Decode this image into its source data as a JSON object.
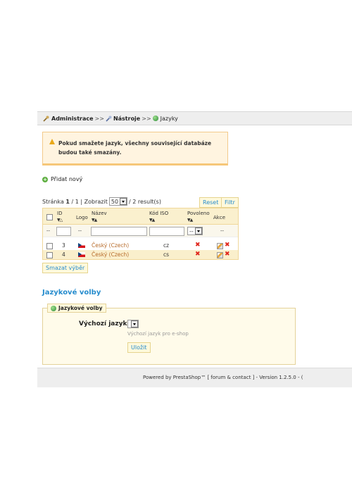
{
  "breadcrumb": {
    "items": [
      "Administrace",
      "Nástroje",
      "Jazyky"
    ],
    "separator": ">>"
  },
  "warning": {
    "text": "Pokud smažete jazyk, všechny související databáze budou také smazány."
  },
  "add_new": {
    "label": "Přidat nový"
  },
  "pager": {
    "page_label": "Stránka",
    "page_current": "1",
    "page_total": "/ 1 | Zobrazit",
    "per_page": "50",
    "results": "/ 2 result(s)",
    "reset_label": "Reset",
    "filter_label": "Filtr"
  },
  "table": {
    "headers": {
      "id": "ID",
      "logo": "Logo",
      "name": "Název",
      "iso": "Kód ISO",
      "active": "Povoleno",
      "actions": "Akce"
    },
    "filter": {
      "dash": "--",
      "active_select": "--"
    },
    "rows": [
      {
        "id": "3",
        "name": "Český (Czech)",
        "iso": "cz"
      },
      {
        "id": "4",
        "name": "Český (Czech)",
        "iso": "cs"
      }
    ],
    "delete_selected": "Smazat výběr"
  },
  "section": {
    "title": "Jazykové volby",
    "legend": "Jazykové volby",
    "default_language_label": "Výchozí jazyk:",
    "default_language_hint": "Výchozí jazyk pro e-shop",
    "save_label": "Uložit"
  },
  "footer": {
    "text": "Powered by PrestaShop™ [ forum & contact ] - Version 1.2.5.0 - ("
  },
  "colors": {
    "accent": "#268ccd",
    "warning_bg": "#fff4e0",
    "header_bg": "#faf0ce",
    "delete_red": "#e0271d"
  }
}
